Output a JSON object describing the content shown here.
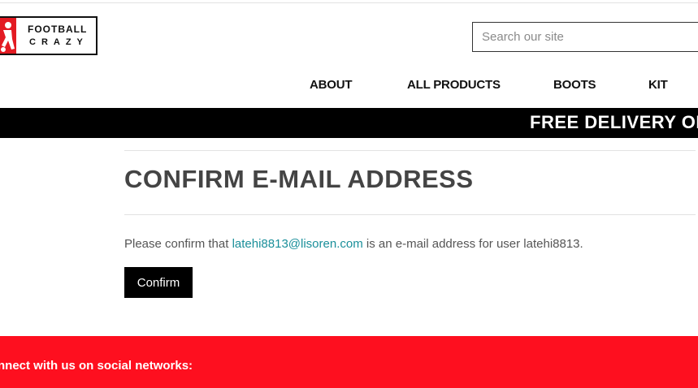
{
  "logo": {
    "line1": "FOOTBALL",
    "line2": "CRAZY",
    "icon": "footballer-icon"
  },
  "search": {
    "placeholder": "Search our site",
    "value": ""
  },
  "nav": {
    "items": [
      {
        "label": "ABOUT"
      },
      {
        "label": "ALL PRODUCTS"
      },
      {
        "label": "BOOTS"
      },
      {
        "label": "KIT"
      }
    ]
  },
  "banner": {
    "text": "FREE DELIVERY ON"
  },
  "main": {
    "title": "CONFIRM E-MAIL ADDRESS",
    "message_prefix": "Please confirm that ",
    "email": "latehi8813@lisoren.com",
    "message_suffix": " is an e-mail address for user latehi8813.",
    "confirm_label": "Confirm"
  },
  "footer": {
    "social_text": "nnect with us on social networks:"
  },
  "colors": {
    "banner_bg": "#000000",
    "footer_bg": "#fe0f1f",
    "link": "#1a8f9a",
    "button_bg": "#000000"
  }
}
